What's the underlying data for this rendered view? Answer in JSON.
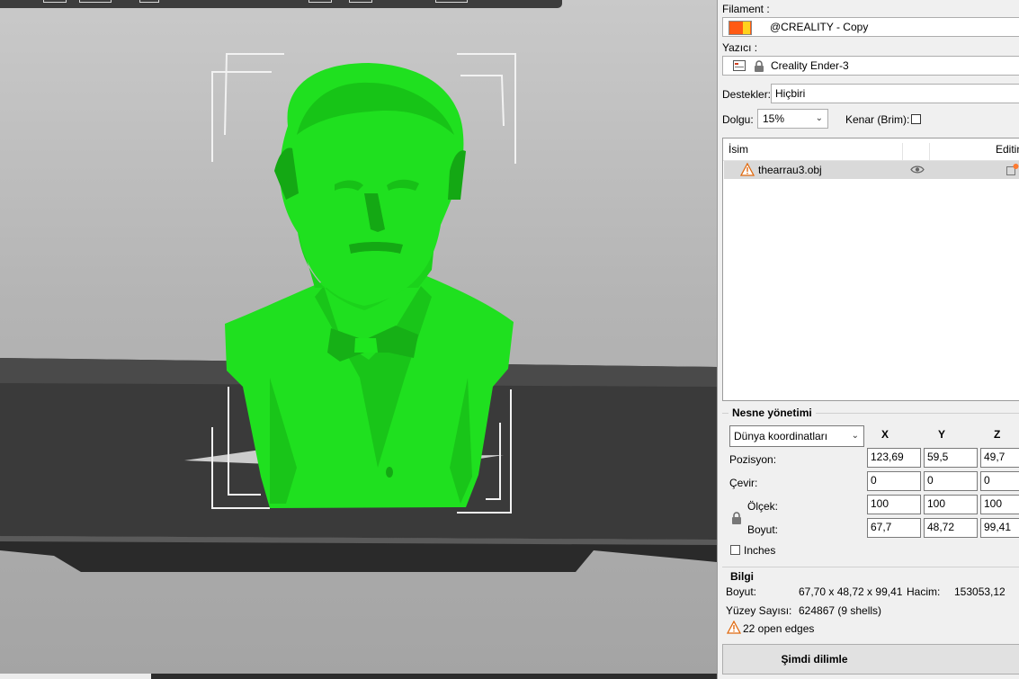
{
  "sidebar": {
    "filament_label": "Filament :",
    "filament_value": "@CREALITY - Copy",
    "printer_label": "Yazıcı :",
    "printer_value": "Creality Ender-3",
    "supports_label": "Destekler:",
    "supports_value": "Hiçbiri",
    "infill_label": "Dolgu:",
    "infill_value": "15%",
    "brim_label": "Kenar (Brim):",
    "brim_checked": false,
    "list_columns": [
      "İsim",
      "",
      "Editin"
    ],
    "objects": [
      {
        "name": "thearrau3.obj",
        "warning": true,
        "visible": true
      }
    ]
  },
  "object_manipulation": {
    "title": "Nesne yönetimi",
    "coord_mode": "Dünya koordinatları",
    "axes": [
      "X",
      "Y",
      "Z"
    ],
    "rows": [
      {
        "label": "Pozisyon:",
        "values": [
          "123,69",
          "59,5",
          "49,7"
        ]
      },
      {
        "label": "Çevir:",
        "values": [
          "0",
          "0",
          "0"
        ]
      },
      {
        "label": "Ölçek:",
        "values": [
          "100",
          "100",
          "100"
        ]
      },
      {
        "label": "Boyut:",
        "values": [
          "67,7",
          "48,72",
          "99,41"
        ]
      }
    ],
    "inches_label": "Inches",
    "inches_checked": false
  },
  "info": {
    "title": "Bilgi",
    "size_label": "Boyut:",
    "size_value": "67,70 x 48,72 x 99,41",
    "volume_label": "Hacim:",
    "volume_value": "153053,12",
    "facets_label": "Yüzey Sayısı:",
    "facets_value": "624867 (9 shells)",
    "warning_text": "22 open edges"
  },
  "actions": {
    "slice_now": "Şimdi dilimle"
  },
  "colors": {
    "model": "#1fe01f",
    "model_shadow": "#14a814",
    "bed": "#3b3b3b",
    "filament_swatch_main": "#ff5a14",
    "filament_swatch_accent": "#ffd21e",
    "warning": "#e8a020"
  },
  "icons": {
    "filament_swatch": "color-swatch-icon",
    "printer": "printer-icon",
    "lock": "lock-icon",
    "warning": "warning-triangle-icon",
    "visibility": "eye-icon",
    "edit": "edit-icon"
  }
}
